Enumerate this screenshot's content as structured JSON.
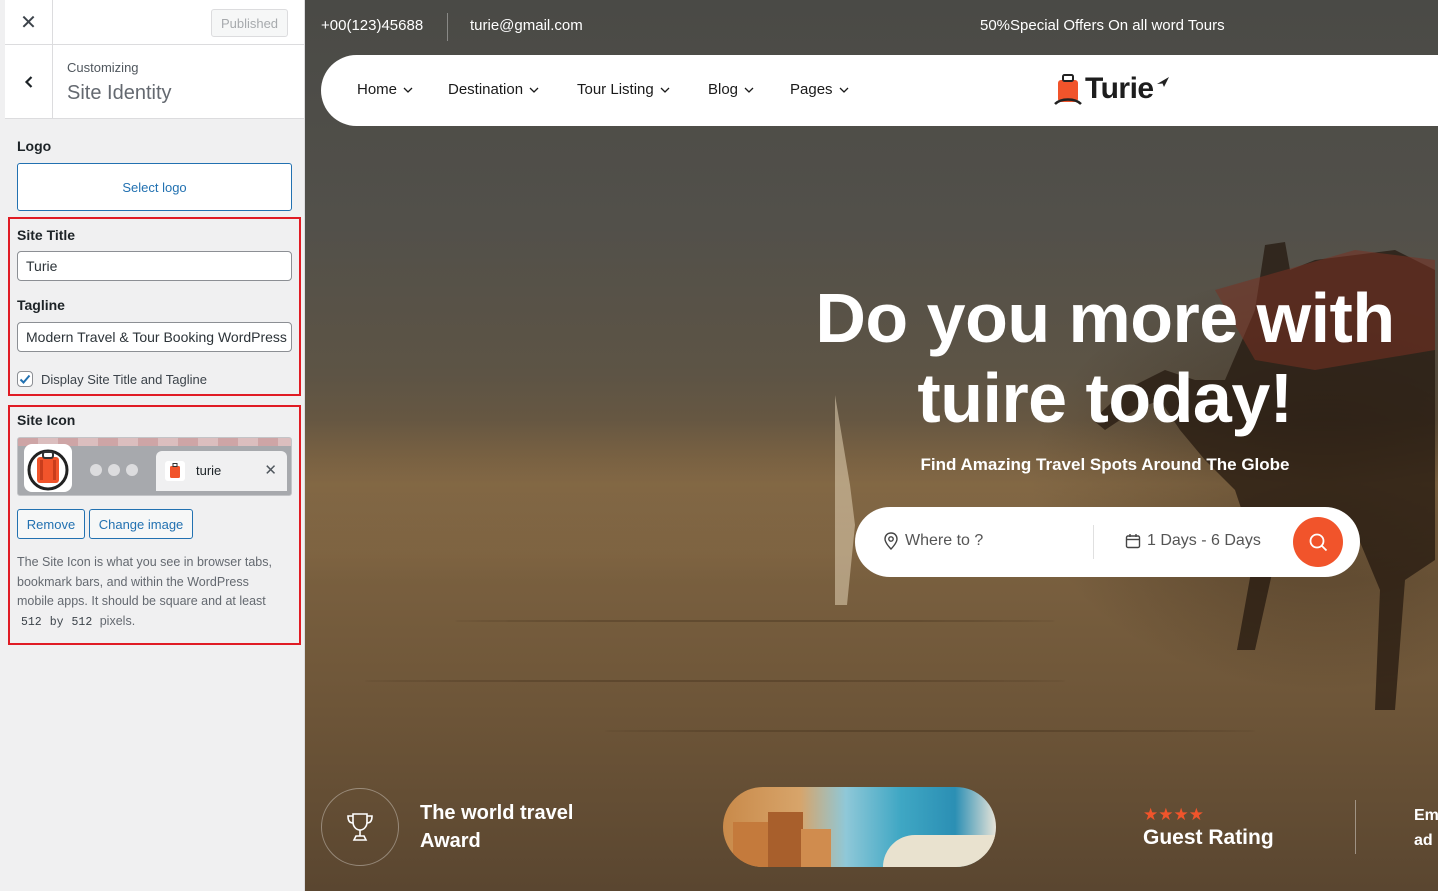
{
  "customizer": {
    "close_icon": "close-icon",
    "published_label": "Published",
    "customizing_label": "Customizing",
    "section_title": "Site Identity",
    "logo_label": "Logo",
    "select_logo_label": "Select logo",
    "site_title_label": "Site Title",
    "site_title_value": "Turie",
    "tagline_label": "Tagline",
    "tagline_value": "Modern Travel & Tour Booking WordPress",
    "display_title_label": "Display Site Title and Tagline",
    "display_title_checked": true,
    "site_icon_label": "Site Icon",
    "browser_tab_name": "turie",
    "remove_label": "Remove",
    "change_image_label": "Change image",
    "icon_desc_1": "The Site Icon is what you see in browser tabs, bookmark bars, and within the WordPress mobile apps. It should be square and at least",
    "icon_code_1": "512",
    "icon_desc_by": "by",
    "icon_code_2": "512",
    "icon_desc_2": "pixels.",
    "highlight_color": "#e01b24",
    "accent_color": "#2271b1"
  },
  "site": {
    "phone": "+00(123)45688",
    "email": "turie@gmail.com",
    "offer": "50%Special Offers On all word Tours",
    "nav": [
      "Home",
      "Destination",
      "Tour Listing",
      "Blog",
      "Pages"
    ],
    "logo_text": "Turie",
    "hero_title_line1": "Do you more with",
    "hero_title_line2": "tuire today!",
    "hero_subtitle": "Find Amazing Travel Spots Around The Globe",
    "search_placeholder": "Where to ?",
    "days_value": "1 Days - 6 Days",
    "award_line1": "The world travel",
    "award_line2": "Award",
    "rating_label": "Guest Rating",
    "stars": "★★★★",
    "clip_line1": "Em",
    "clip_line2": "ad",
    "brand_color": "#f1542b"
  }
}
